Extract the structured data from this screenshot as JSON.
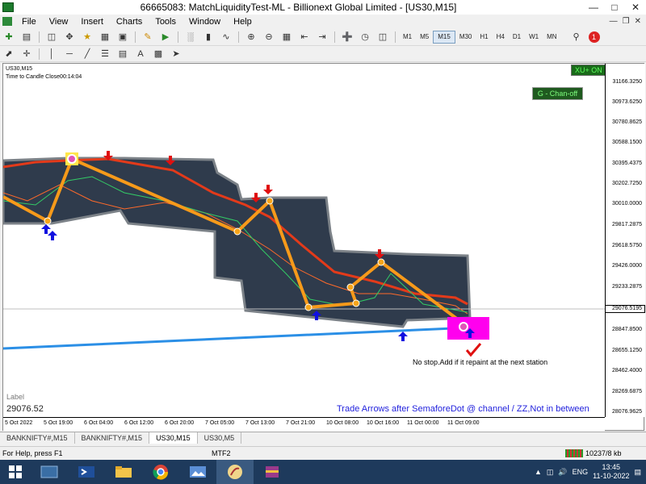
{
  "window": {
    "title": "66665083: MatchLiquidityTest-ML - Billionext Global Limited - [US30,M15]"
  },
  "menu": [
    "File",
    "View",
    "Insert",
    "Charts",
    "Tools",
    "Window",
    "Help"
  ],
  "timeframes": [
    "M1",
    "M5",
    "M15",
    "M30",
    "H1",
    "H4",
    "D1",
    "W1",
    "MN"
  ],
  "active_timeframe": "M15",
  "notification_count": "1",
  "chart": {
    "symbol": "US30,M15",
    "candle_timer": "Time to Candle Close00:14:04",
    "current_price": "29076.5195",
    "label_title": "Label",
    "label_value": "29076.52",
    "note_stop": "No stop.Add if it repaint at the next station",
    "note_arrows": "Trade Arrows after SemaforeDot @ channel / ZZ,Not in between",
    "button_xu": "XU+ ON",
    "button_chan": "G - Chan-off",
    "y_ticks": [
      "31166.3250",
      "30973.6250",
      "30780.8625",
      "30588.1500",
      "30395.4375",
      "30202.7250",
      "30010.0000",
      "29817.2875",
      "29618.5750",
      "29426.0000",
      "29233.2875",
      "29040.5750",
      "28847.8500",
      "28655.1250",
      "28462.4000",
      "28269.6875",
      "28076.9625"
    ],
    "x_ticks": [
      "5 Oct 2022",
      "5 Oct 19:00",
      "6 Oct 04:00",
      "6 Oct 12:00",
      "6 Oct 20:00",
      "7 Oct 05:00",
      "7 Oct 13:00",
      "7 Oct 21:00",
      "10 Oct 08:00",
      "10 Oct 16:00",
      "11 Oct 00:00",
      "11 Oct 09:00"
    ]
  },
  "tabs": [
    "BANKNIFTY#,M15",
    "BANKNIFTY#,M15",
    "US30,M15",
    "US30,M5"
  ],
  "active_tab": "US30,M15",
  "status": {
    "help": "For Help, press F1",
    "profile": "MTF2",
    "connection": "10237/8 kb"
  },
  "taskbar": {
    "lang": "ENG",
    "time": "13:45",
    "date": "11-10-2022"
  }
}
